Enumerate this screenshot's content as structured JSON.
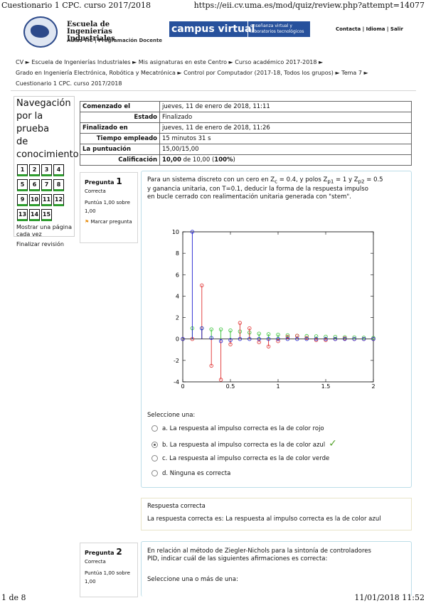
{
  "print_header": {
    "title": "Cuestionario 1 CPC. curso 2017/2018",
    "url": "https://eii.cv.uma.es/mod/quiz/review.php?attempt=14077"
  },
  "print_footer": {
    "page": "1 de 8",
    "datetime": "11/01/2018 11:52"
  },
  "site": {
    "school_name": "Escuela de Ingenierías Industriales",
    "subtitle": "Aulas TIC | Programación Docente",
    "campus_title": "campus virtual",
    "campus_sub1": "enseñanza virtual y",
    "campus_sub2": "laboratorios tecnológicos",
    "top_links": "Contacta | Idioma | Salir"
  },
  "breadcrumb": [
    "CV",
    "Escuela de Ingenierías Industriales",
    "Mis asignaturas en este Centro",
    "Curso académico 2017-2018",
    "Grado en Ingeniería Electrónica, Robótica y Mecatrónica",
    "Control por Computador (2017-18, Todos los grupos)",
    "Tema 7",
    "Cuestionario 1 CPC. curso 2017/2018"
  ],
  "nav": {
    "title_lines": [
      "Navegación",
      "por la prueba",
      "de",
      "conocimiento"
    ],
    "buttons": [
      "1",
      "2",
      "3",
      "4",
      "5",
      "6",
      "7",
      "8",
      "9",
      "10",
      "11",
      "12",
      "13",
      "14",
      "15"
    ],
    "show_one_page": "Mostrar una página cada vez",
    "finish_review": "Finalizar revisión"
  },
  "summary": {
    "started_label": "Comenzado el",
    "started_value": "jueves, 11 de enero de 2018, 11:11",
    "state_label": "Estado",
    "state_value": "Finalizado",
    "finished_label": "Finalizado en",
    "finished_value": "jueves, 11 de enero de 2018, 11:26",
    "time_label": "Tiempo empleado",
    "time_value": "15 minutos 31 s",
    "points_label": "La puntuación",
    "points_value": "15,00/15,00",
    "grade_label": "Calificación",
    "grade_value": "10,00",
    "grade_suffix": " de 10,00 (",
    "grade_pct": "100%",
    "grade_close": ")"
  },
  "q1": {
    "label": "Pregunta",
    "number": "1",
    "status": "Correcta",
    "points": "Puntúa 1,00 sobre 1,00",
    "flag": "Marcar pregunta",
    "text_line1": "Para un sistema discreto con un cero en Z",
    "sub_c": "c",
    "text_l1_a": " = 0.4, y polos Z",
    "sub_p1": "p1",
    "text_l1_b": " = 1 y Z",
    "sub_p2": "p2",
    "text_l1_c": " = 0.5",
    "text_line2": " y ganancia unitaria,  con T=0.1, deducir la forma de la respuesta impulso",
    "text_line3": "en bucle cerrado con realimentación unitaria generada con \"stem\".",
    "select_one": "Seleccione una:",
    "options": [
      "a. La respuesta al impulso correcta es la de color rojo",
      "b. La respuesta al impulso correcta es la de color azul",
      "c. La respuesta al impulso correcta es la de color verde",
      "d. Ninguna es correcta"
    ],
    "feedback_title": "Respuesta correcta",
    "feedback_text": "La respuesta correcta es: La respuesta al impulso correcta es la de color azul"
  },
  "q2": {
    "label": "Pregunta",
    "number": "2",
    "status": "Correcta",
    "points": "Puntúa 1,00 sobre 1,00",
    "text_line1": "En relación al método de Ziegler-Nichols para la sintonía de controladores",
    "text_line2": "PID, indicar cuál de las siguientes afirmaciones es correcta:",
    "select_many": "Seleccione una o más de una:"
  },
  "chart_data": {
    "type": "scatter",
    "xlim": [
      0,
      2
    ],
    "ylim": [
      -4,
      10
    ],
    "xticks": [
      0,
      0.5,
      1,
      1.5,
      2
    ],
    "xtick_labels": [
      "0",
      "0.5",
      "1",
      "1.5",
      "2"
    ],
    "yticks": [
      10,
      8,
      6,
      4,
      2,
      0,
      -2,
      -4
    ],
    "ytick_labels": [
      "10",
      "8",
      "6",
      "4",
      "2",
      "0",
      "-2",
      "-4"
    ],
    "grid": false,
    "colors": {
      "red": "#e03030",
      "blue": "#2020d0",
      "green": "#30c030"
    },
    "series": [
      {
        "color": "blue",
        "x": [
          0,
          0.1,
          0.2,
          0.3,
          0.4,
          0.5,
          0.6,
          0.7,
          0.8,
          0.9,
          1.0,
          1.1,
          1.2,
          1.3,
          1.4,
          1.5,
          1.6,
          1.7,
          1.8,
          1.9,
          2.0
        ],
        "y": [
          0,
          10,
          1,
          0.1,
          -0.2,
          -0.1,
          0,
          0,
          0,
          0,
          0,
          0,
          0,
          0,
          0,
          0,
          0,
          0,
          0,
          0,
          0
        ]
      },
      {
        "color": "red",
        "x": [
          0,
          0.1,
          0.2,
          0.3,
          0.4,
          0.5,
          0.6,
          0.7,
          0.8,
          0.9,
          1.0,
          1.1,
          1.2,
          1.3,
          1.4,
          1.5,
          1.6,
          1.7,
          1.8,
          1.9,
          2.0
        ],
        "y": [
          0,
          0,
          5,
          -2.5,
          -3.8,
          -0.5,
          1.5,
          1.0,
          -0.3,
          -0.7,
          -0.2,
          0.2,
          0.3,
          0.1,
          -0.1,
          -0.1,
          0,
          0.05,
          0,
          0,
          0
        ]
      },
      {
        "color": "green",
        "x": [
          0,
          0.1,
          0.2,
          0.3,
          0.4,
          0.5,
          0.6,
          0.7,
          0.8,
          0.9,
          1.0,
          1.1,
          1.2,
          1.3,
          1.4,
          1.5,
          1.6,
          1.7,
          1.8,
          1.9,
          2.0
        ],
        "y": [
          0,
          1,
          1,
          0.9,
          0.9,
          0.8,
          0.7,
          0.6,
          0.5,
          0.45,
          0.4,
          0.35,
          0.3,
          0.28,
          0.25,
          0.22,
          0.2,
          0.17,
          0.15,
          0.12,
          0.1
        ]
      }
    ]
  }
}
